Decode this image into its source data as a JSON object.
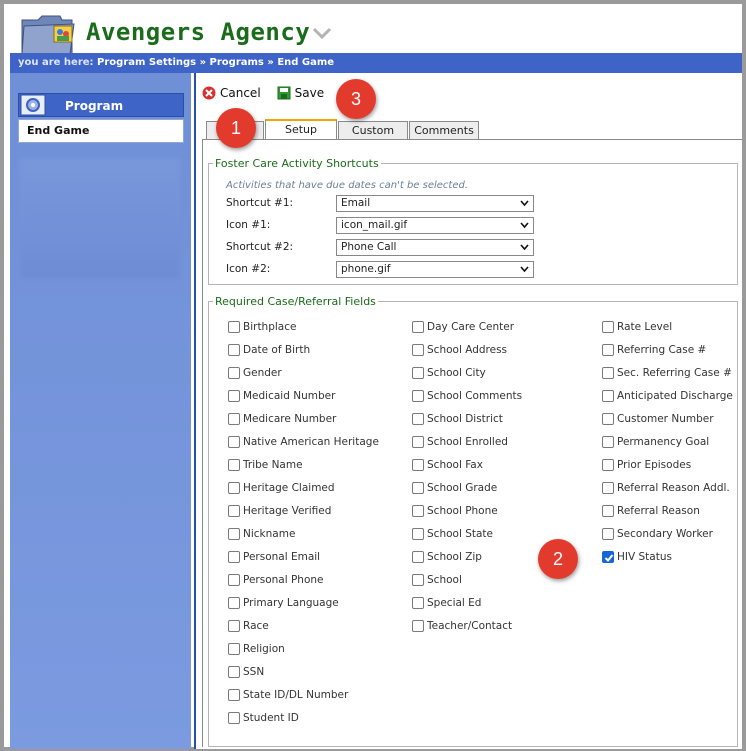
{
  "app": {
    "title": "Avengers Agency"
  },
  "breadcrumb": {
    "prefix": "you are here:",
    "items": [
      "Program Settings",
      "Programs",
      "End Game"
    ],
    "separator": "»"
  },
  "sidebar": {
    "header": "Program",
    "item": "End Game"
  },
  "toolbar": {
    "cancel_label": "Cancel",
    "save_label": "Save"
  },
  "tabs": [
    {
      "label": "Setup",
      "active": true
    },
    {
      "label": "Custom",
      "active": false
    },
    {
      "label": "Comments",
      "active": false
    }
  ],
  "shortcuts": {
    "legend": "Foster Care Activity Shortcuts",
    "hint": "Activities that have due dates can't be selected.",
    "rows": [
      {
        "label": "Shortcut #1:",
        "value": "Email"
      },
      {
        "label": "Icon #1:",
        "value": "icon_mail.gif"
      },
      {
        "label": "Shortcut #2:",
        "value": "Phone Call"
      },
      {
        "label": "Icon #2:",
        "value": "phone.gif"
      }
    ]
  },
  "required": {
    "legend": "Required Case/Referral Fields",
    "col1": [
      "Birthplace",
      "Date of Birth",
      "Gender",
      "Medicaid Number",
      "Medicare Number",
      "Native American Heritage",
      "Tribe Name",
      "Heritage Claimed",
      "Heritage Verified",
      "Nickname",
      "Personal Email",
      "Personal Phone",
      "Primary Language",
      "Race",
      "Religion",
      "SSN",
      "State ID/DL Number",
      "Student ID"
    ],
    "col2": [
      "Day Care Center",
      "School Address",
      "School City",
      "School Comments",
      "School District",
      "School Enrolled",
      "School Fax",
      "School Grade",
      "School Phone",
      "School State",
      "School Zip",
      "School",
      "Special Ed",
      "Teacher/Contact"
    ],
    "col3": [
      "Rate Level",
      "Referring Case #",
      "Sec. Referring Case #",
      "Anticipated Discharge",
      "Customer Number",
      "Permanency Goal",
      "Prior Episodes",
      "Referral Reason Addl.",
      "Referral Reason",
      "Secondary Worker",
      "HIV Status"
    ],
    "checked": [
      "HIV Status"
    ]
  },
  "callouts": [
    "1",
    "2",
    "3"
  ],
  "colors": {
    "brand": "#1a6b1a",
    "nav": "#3d64c6",
    "callout": "#e23b2e",
    "check": "#1565d8"
  }
}
